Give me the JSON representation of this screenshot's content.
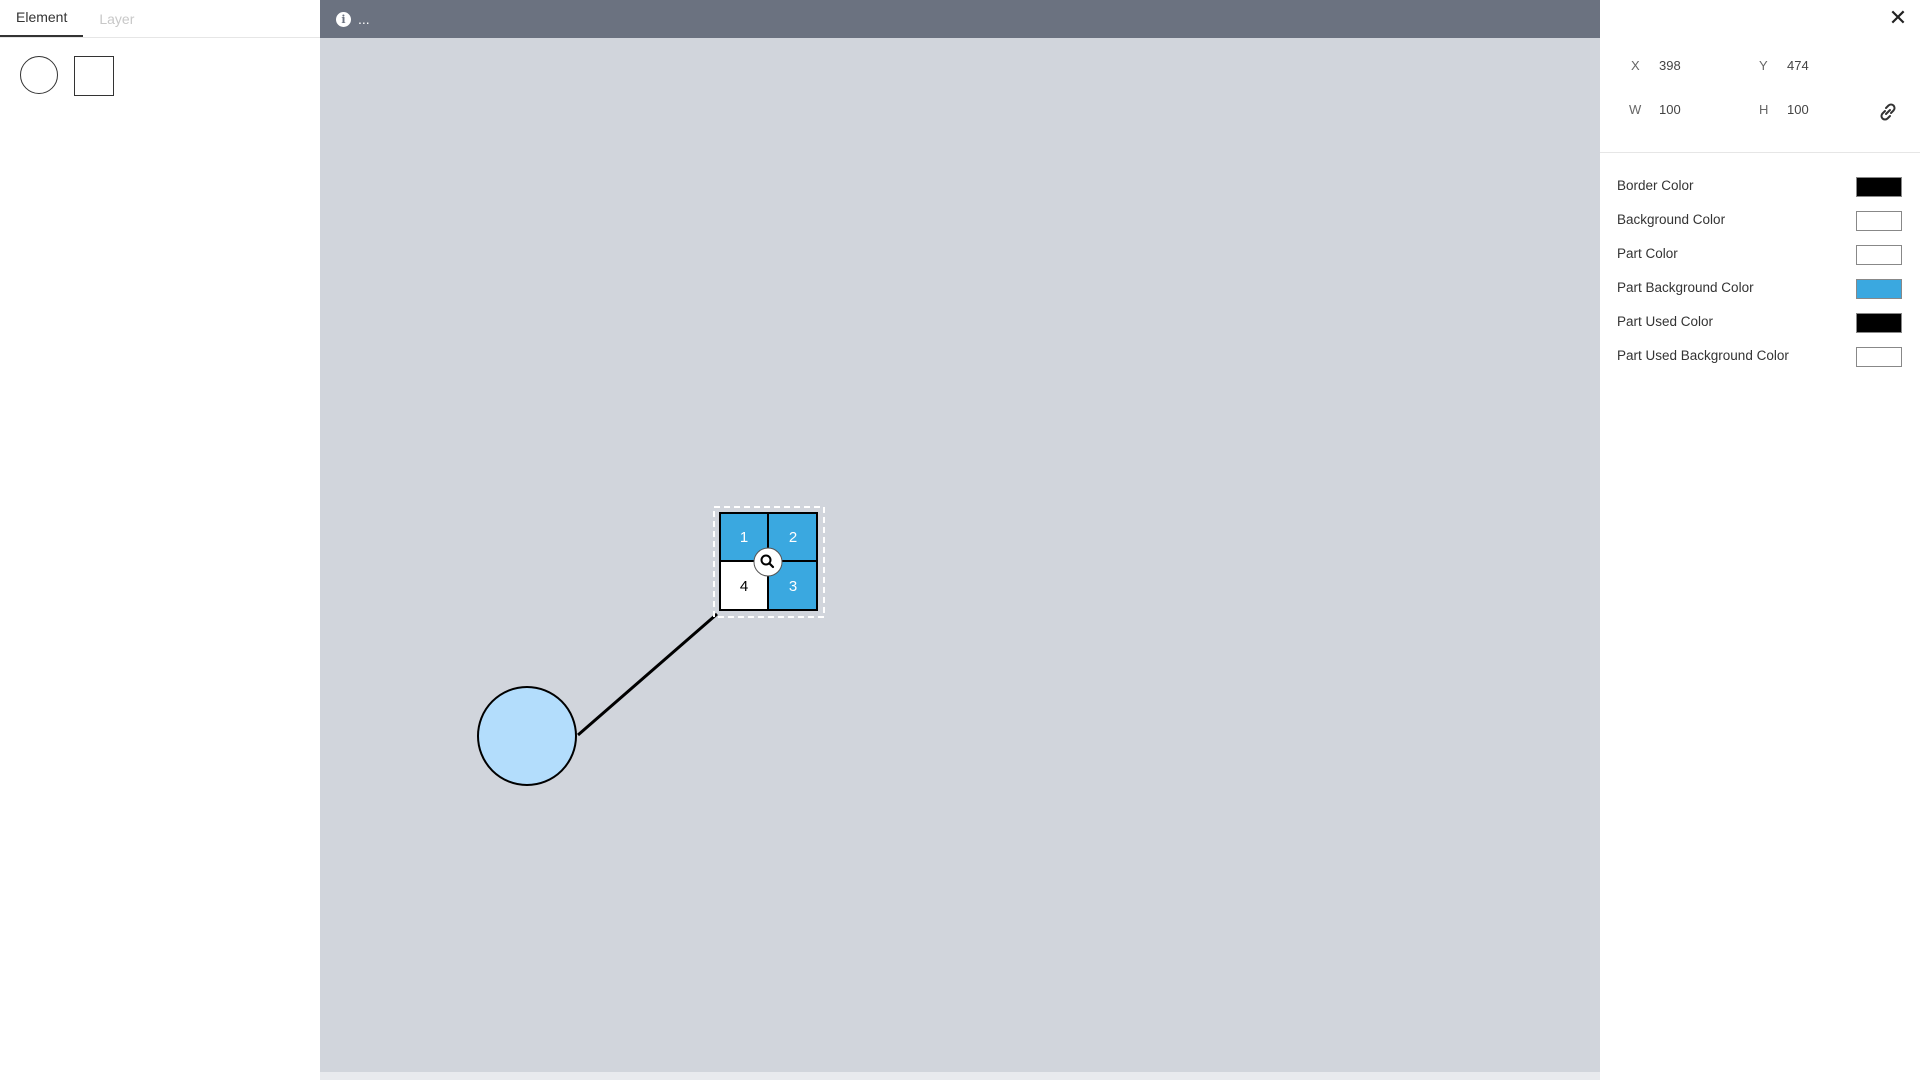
{
  "left_panel": {
    "tabs": [
      {
        "label": "Element",
        "active": true
      },
      {
        "label": "Layer",
        "active": false
      }
    ]
  },
  "canvas": {
    "topbar_text": "...",
    "colors": {
      "background": "#d1d5dc",
      "topbar": "#6b7280",
      "circle_fill": "#b3ddfc",
      "part_blue": "#3aa8e0"
    },
    "parts": [
      "1",
      "2",
      "4",
      "3"
    ]
  },
  "properties": {
    "x_label": "X",
    "x_value": "398",
    "y_label": "Y",
    "y_value": "474",
    "w_label": "W",
    "w_value": "100",
    "h_label": "H",
    "h_value": "100",
    "colors": [
      {
        "label": "Border Color",
        "value": "#000000"
      },
      {
        "label": "Background Color",
        "value": "#ffffff"
      },
      {
        "label": "Part Color",
        "value": "#ffffff"
      },
      {
        "label": "Part Background Color",
        "value": "#3aa8e0"
      },
      {
        "label": "Part Used Color",
        "value": "#000000"
      },
      {
        "label": "Part Used Background Color",
        "value": "#ffffff"
      }
    ]
  }
}
